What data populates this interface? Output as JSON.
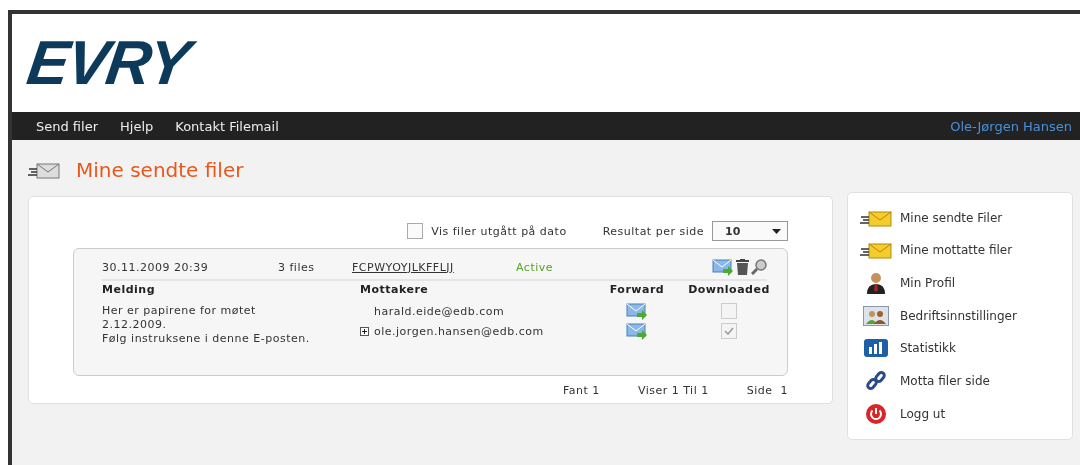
{
  "logo": "EVRY",
  "nav": {
    "links": [
      "Send filer",
      "Hjelp",
      "Kontakt Filemail"
    ],
    "user": "Ole-Jørgen Hansen"
  },
  "page_title": "Mine sendte filer",
  "filter": {
    "label": "Vis filer utgått på dato",
    "checked": false
  },
  "per_page": {
    "label": "Resultat per side",
    "value": "10"
  },
  "transfers": [
    {
      "date": "30.11.2009 20:39",
      "files": "3 files",
      "code": "FCPWYOYJLKFFLJJ",
      "status": "Active",
      "columns": [
        "Melding",
        "Mottakere",
        "Forward",
        "Downloaded"
      ],
      "message": [
        "Her er papirene for møtet",
        "2.12.2009.",
        "Følg instruksene i denne E-posten."
      ],
      "recipients": [
        {
          "email": "harald.eide@edb.com",
          "expandable": false,
          "downloaded": false
        },
        {
          "email": "ole.jorgen.hansen@edb.com",
          "expandable": true,
          "downloaded": true
        }
      ]
    }
  ],
  "pager": {
    "found": "Fant 1",
    "showing": "Viser 1 Til 1",
    "page": "Side  1"
  },
  "sidebar": {
    "items": [
      {
        "kind": "sent",
        "label": "Mine sendte Filer"
      },
      {
        "kind": "received",
        "label": "Mine mottatte filer"
      },
      {
        "kind": "profile",
        "label": "Min Profil"
      },
      {
        "kind": "company",
        "label": "Bedriftsinnstillinger"
      },
      {
        "kind": "stats",
        "label": "Statistikk"
      },
      {
        "kind": "link",
        "label": "Motta filer side"
      },
      {
        "kind": "logout",
        "label": "Logg ut"
      }
    ]
  }
}
